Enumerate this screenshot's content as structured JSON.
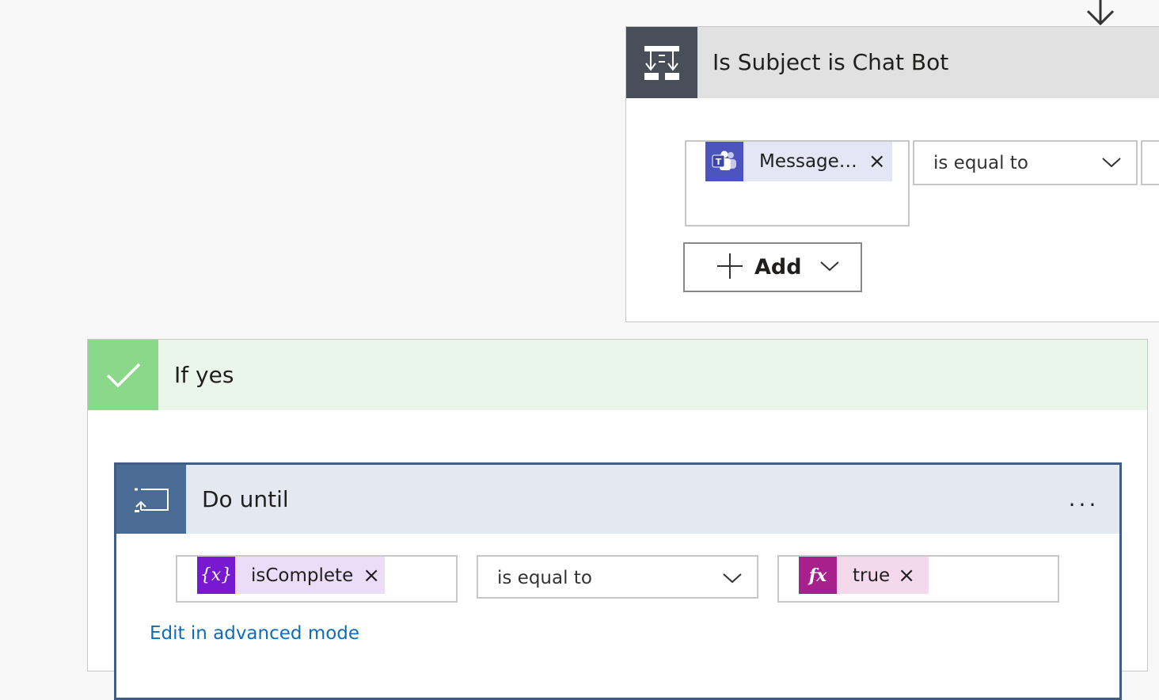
{
  "colors": {
    "condition_icon_bg": "#484f58",
    "condition_header_bg": "#e1e1e1",
    "yes_icon_bg": "#8ad88a",
    "yes_header_bg": "#eaf6ea",
    "until_icon_bg": "#4a6b93",
    "until_header_bg": "#e4e8f0",
    "teams_token": "#4b53bc",
    "variable_token": "#7719d1",
    "expression_token": "#a8208c",
    "link": "#0f6cbd"
  },
  "icons": {
    "connector": "arrow-down-icon",
    "condition": "condition-icon",
    "teams": "teams-icon",
    "yes": "checkmark-icon",
    "until": "do-until-icon",
    "variable": "variable-icon",
    "expression": "expression-icon"
  },
  "condition": {
    "title": "Is Subject is Chat Bot",
    "left_token": {
      "label": "Message…",
      "remove": "×"
    },
    "operator": "is equal to",
    "add_label": "Add"
  },
  "if_yes": {
    "title": "If yes"
  },
  "do_until": {
    "title": "Do until",
    "more": "...",
    "left_token": {
      "icon_text": "{x}",
      "label": "isComplete",
      "remove": "×"
    },
    "operator": "is equal to",
    "right_token": {
      "icon_text": "fx",
      "label": "true",
      "remove": "×"
    },
    "edit_advanced": "Edit in advanced mode"
  }
}
